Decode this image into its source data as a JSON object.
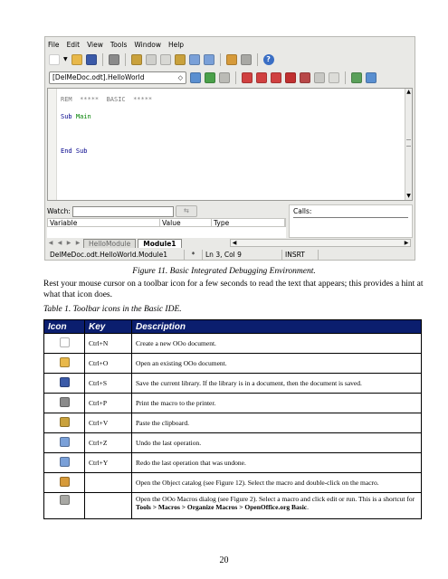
{
  "ide": {
    "menu": [
      "File",
      "Edit",
      "View",
      "Tools",
      "Window",
      "Help"
    ],
    "module_combo": "[DelMeDoc.odt].HelloWorld",
    "code": {
      "line1": "REM  *****  BASIC  *****",
      "line2_kw": "Sub",
      "line2_id": "Main",
      "line3_kw": "End",
      "line3_id": "Sub"
    },
    "watch_label": "Watch:",
    "columns": {
      "variable": "Variable",
      "value": "Value",
      "type": "Type"
    },
    "calls_label": "Calls:",
    "tabs": [
      "HelloModule",
      "Module1"
    ],
    "status": {
      "location": "DelMeDoc.odt.HelloWorld.Module1",
      "modified": "*",
      "position": "Ln 3, Col 9",
      "mode": "INSRT"
    },
    "colors": {
      "help_icon": "#3a6ec4",
      "comment": "#7a7a7a",
      "keyword": "#00008b",
      "identifier": "#008000"
    },
    "toolbar1_icons": [
      "new-document-icon",
      "dropdown-arrow-icon",
      "open-folder-icon",
      "save-icon",
      "print-icon",
      "paste-icon",
      "cut-icon",
      "copy-icon",
      "paste-icon",
      "undo-icon",
      "redo-icon",
      "object-catalog-icon",
      "macros-dialog-icon",
      "help-icon"
    ],
    "toolbar2_icons": [
      "compile-icon",
      "run-icon",
      "stop-icon",
      "step-into-icon",
      "step-over-icon",
      "step-out-icon",
      "breakpoint-icon",
      "manage-breakpoints-icon",
      "watch-icon",
      "find-parentheses-icon",
      "insert-source-icon",
      "import-dialog-icon"
    ]
  },
  "figure_caption": "Figure 11. Basic Integrated Debugging Environment.",
  "paragraph": "Rest your mouse cursor on a toolbar icon for a few seconds to read the text that appears; this provides a hint at what that icon does.",
  "table_caption": "Table 1. Toolbar icons in the Basic IDE.",
  "table": {
    "headers": {
      "icon": "Icon",
      "key": "Key",
      "description": "Description"
    },
    "header_bg": "#0b1e6e",
    "rows": [
      {
        "icon": "new-document-icon",
        "key": "Ctrl+N",
        "desc": "Create a new OOo document."
      },
      {
        "icon": "open-folder-icon",
        "key": "Ctrl+O",
        "desc": "Open an existing OOo document."
      },
      {
        "icon": "save-icon",
        "key": "Ctrl+S",
        "desc": "Save the current library. If the library is in a document, then the document is saved."
      },
      {
        "icon": "print-icon",
        "key": "Ctrl+P",
        "desc": "Print the macro to the printer."
      },
      {
        "icon": "paste-icon",
        "key": "Ctrl+V",
        "desc": "Paste the clipboard."
      },
      {
        "icon": "undo-icon",
        "key": "Ctrl+Z",
        "desc": "Undo the last operation."
      },
      {
        "icon": "redo-icon",
        "key": "Ctrl+Y",
        "desc": "Redo the last operation that was undone."
      },
      {
        "icon": "object-catalog-icon",
        "key": "",
        "desc": "Open the Object catalog (see Figure 12). Select the macro and double-click on the macro."
      },
      {
        "icon": "macros-dialog-icon",
        "key": "",
        "desc_pre": "Open the OOo Macros dialog (see Figure 2). Select a macro and click edit or run. This is a shortcut for ",
        "desc_bold": "Tools > Macros > Organize Macros > OpenOffice.org Basic",
        "desc_post": "."
      }
    ]
  },
  "page_number": "20"
}
